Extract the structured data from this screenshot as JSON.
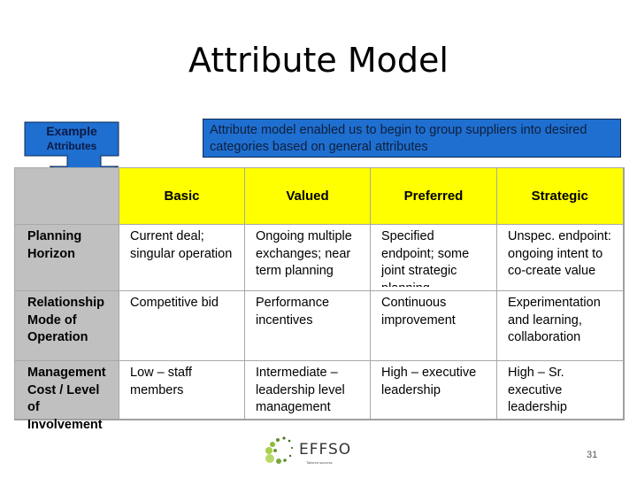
{
  "slide": {
    "title": "Attribute Model",
    "page_number": "31"
  },
  "callout": {
    "line1": "Example",
    "line2": "Attributes",
    "color": "#1f6fd0"
  },
  "note": {
    "text": "Attribute model enabled us to begin to group suppliers into desired categories based on general attributes",
    "color": "#1f6fd0"
  },
  "table": {
    "header_color": "#ffff00",
    "rowhead_color": "#c0c0c0",
    "columns": [
      "",
      "Basic",
      "Valued",
      "Preferred",
      "Strategic"
    ],
    "rows": [
      {
        "label": "Planning Horizon",
        "cells": [
          "Current deal; singular operation",
          "Ongoing multiple exchanges; near term planning",
          "Specified endpoint; some joint strategic planning",
          "Unspec. endpoint: ongoing intent to co-create value"
        ]
      },
      {
        "label": "Relationship Mode of Operation",
        "cells": [
          "Competitive bid",
          "Performance incentives",
          "Continuous improvement",
          "Experimentation and learning, collaboration"
        ]
      },
      {
        "label": "Management Cost / Level of Involvement",
        "cells": [
          "Low – staff members",
          "Intermediate – leadership level management",
          "High – executive leadership",
          "High – Sr. executive leadership"
        ]
      }
    ]
  },
  "logo": {
    "name": "EFFSO",
    "tagline": "Tailored success"
  }
}
